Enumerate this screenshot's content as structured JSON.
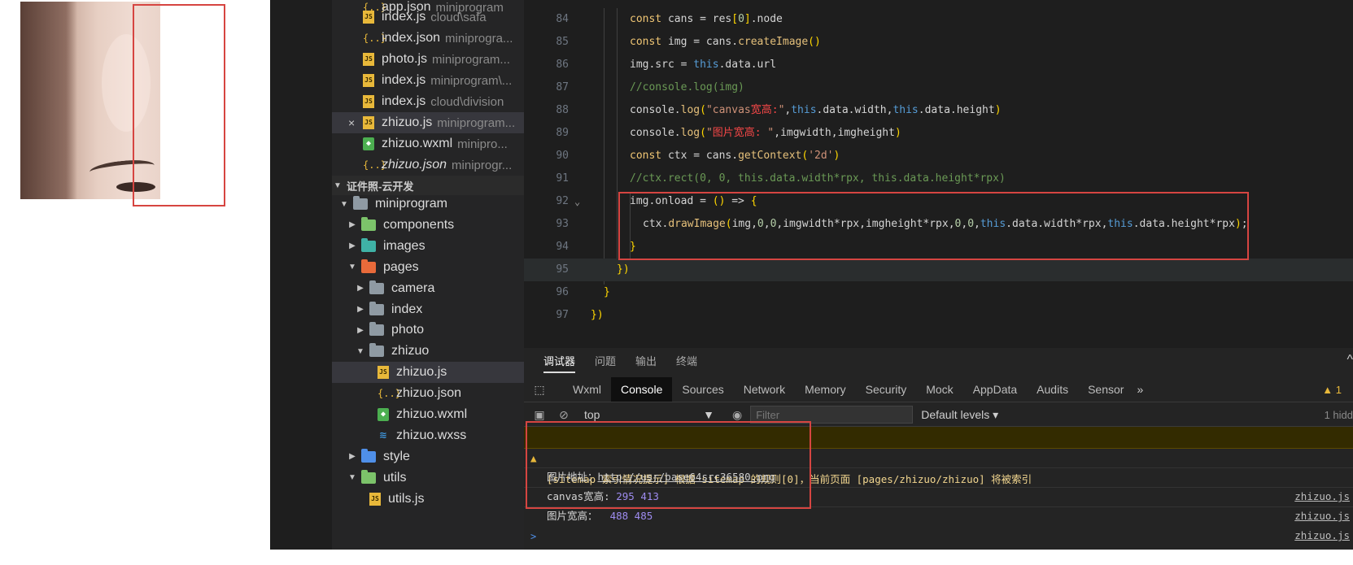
{
  "tree": {
    "open_files": [
      {
        "name": "app.json",
        "path": "miniprogram",
        "icon": "json-file-icon",
        "type": "json"
      },
      {
        "name": "index.js",
        "path": "cloud\\safa",
        "icon": "js-file-icon",
        "type": "js"
      },
      {
        "name": "index.json",
        "path": "miniprogra...",
        "icon": "json-file-icon",
        "type": "json"
      },
      {
        "name": "photo.js",
        "path": "miniprogram...",
        "icon": "js-file-icon",
        "type": "js"
      },
      {
        "name": "index.js",
        "path": "miniprogram\\...",
        "icon": "js-file-icon",
        "type": "js"
      },
      {
        "name": "index.js",
        "path": "cloud\\division",
        "icon": "js-file-icon",
        "type": "js"
      },
      {
        "name": "zhizuo.js",
        "path": "miniprogram...",
        "icon": "js-file-icon",
        "type": "js",
        "selected": true
      },
      {
        "name": "zhizuo.wxml",
        "path": "minipro...",
        "icon": "wxml-file-icon",
        "type": "wxml"
      },
      {
        "name": "zhizuo.json",
        "path": "miniprogr...",
        "icon": "json-file-icon",
        "type": "json",
        "italic": true
      }
    ],
    "section_title": "证件照-云开发",
    "close_glyph": "×",
    "project": [
      {
        "name": "miniprogram",
        "kind": "folder",
        "color": "gray",
        "expanded": true
      },
      {
        "name": "components",
        "kind": "folder",
        "color": "green",
        "expanded": false
      },
      {
        "name": "images",
        "kind": "folder",
        "color": "teal",
        "expanded": false
      },
      {
        "name": "pages",
        "kind": "folder",
        "color": "orange",
        "expanded": true
      },
      {
        "name": "camera",
        "kind": "folder",
        "color": "gray",
        "expanded": false
      },
      {
        "name": "index",
        "kind": "folder",
        "color": "gray",
        "expanded": false
      },
      {
        "name": "photo",
        "kind": "folder",
        "color": "gray",
        "expanded": false
      },
      {
        "name": "zhizuo",
        "kind": "folder",
        "color": "gray",
        "expanded": true
      },
      {
        "name": "zhizuo.js",
        "kind": "js",
        "selected": true
      },
      {
        "name": "zhizuo.json",
        "kind": "json"
      },
      {
        "name": "zhizuo.wxml",
        "kind": "wxml"
      },
      {
        "name": "zhizuo.wxss",
        "kind": "wxss"
      },
      {
        "name": "style",
        "kind": "folder",
        "color": "blue",
        "expanded": false
      },
      {
        "name": "utils",
        "kind": "folder",
        "color": "green",
        "expanded": true
      },
      {
        "name": "utils.js",
        "kind": "js"
      }
    ]
  },
  "editor": {
    "lines": [
      {
        "n": "84",
        "code": "const cans = res[0].node"
      },
      {
        "n": "85",
        "code": "const img = cans.createImage()"
      },
      {
        "n": "86",
        "code": "img.src = this.data.url"
      },
      {
        "n": "87",
        "code": "//console.log(img)"
      },
      {
        "n": "88",
        "code": "console.log(\"canvas宽高:\",this.data.width,this.data.height)"
      },
      {
        "n": "89",
        "code": "console.log(\"图片宽高: \",imgwidth,imgheight)"
      },
      {
        "n": "90",
        "code": "const ctx = cans.getContext('2d')"
      },
      {
        "n": "91",
        "code": "//ctx.rect(0, 0, this.data.width*rpx, this.data.height*rpx)"
      },
      {
        "n": "92",
        "code": "img.onload = () => {"
      },
      {
        "n": "93",
        "code": "ctx.drawImage(img,0,0,imgwidth*rpx,imgheight*rpx,0,0,this.data.width*rpx,this.data.height*rpx);"
      },
      {
        "n": "94",
        "code": "}"
      },
      {
        "n": "95",
        "code": "})"
      },
      {
        "n": "96",
        "code": "}"
      },
      {
        "n": "97",
        "code": "})"
      }
    ]
  },
  "devtools": {
    "panel_tabs": [
      "调试器",
      "问题",
      "输出",
      "终端"
    ],
    "collapse_glyph": "^",
    "tabs": [
      "Wxml",
      "Console",
      "Sources",
      "Network",
      "Memory",
      "Security",
      "Mock",
      "AppData",
      "Audits",
      "Sensor"
    ],
    "more_glyph": "»",
    "active_tab": "Console",
    "warning_count": "1",
    "context": "top",
    "filter_placeholder": "Filter",
    "levels": "Default levels ▾",
    "hidden_count": "1 hidd",
    "console": {
      "warning": "[sitemap 索引情况提示] 根据 sitemap 的规则[0]，当前页面 [pages/zhizuo/zhizuo] 将被索引",
      "row1_label": "图片地址：",
      "row1_link": "http://usr/base64src36580.png",
      "row1_src": "zhizuo.js",
      "row2_label": "canvas宽高: ",
      "row2_value": "295 413",
      "row2_src": "zhizuo.js",
      "row3_label": "图片宽高：  ",
      "row3_value": "488 485",
      "row3_src": "zhizuo.js",
      "prompt": ">"
    }
  },
  "colors": {
    "annotation_red": "#d64541",
    "accent_yellow": "#e8b83a",
    "console_number": "#9e8cf0"
  }
}
